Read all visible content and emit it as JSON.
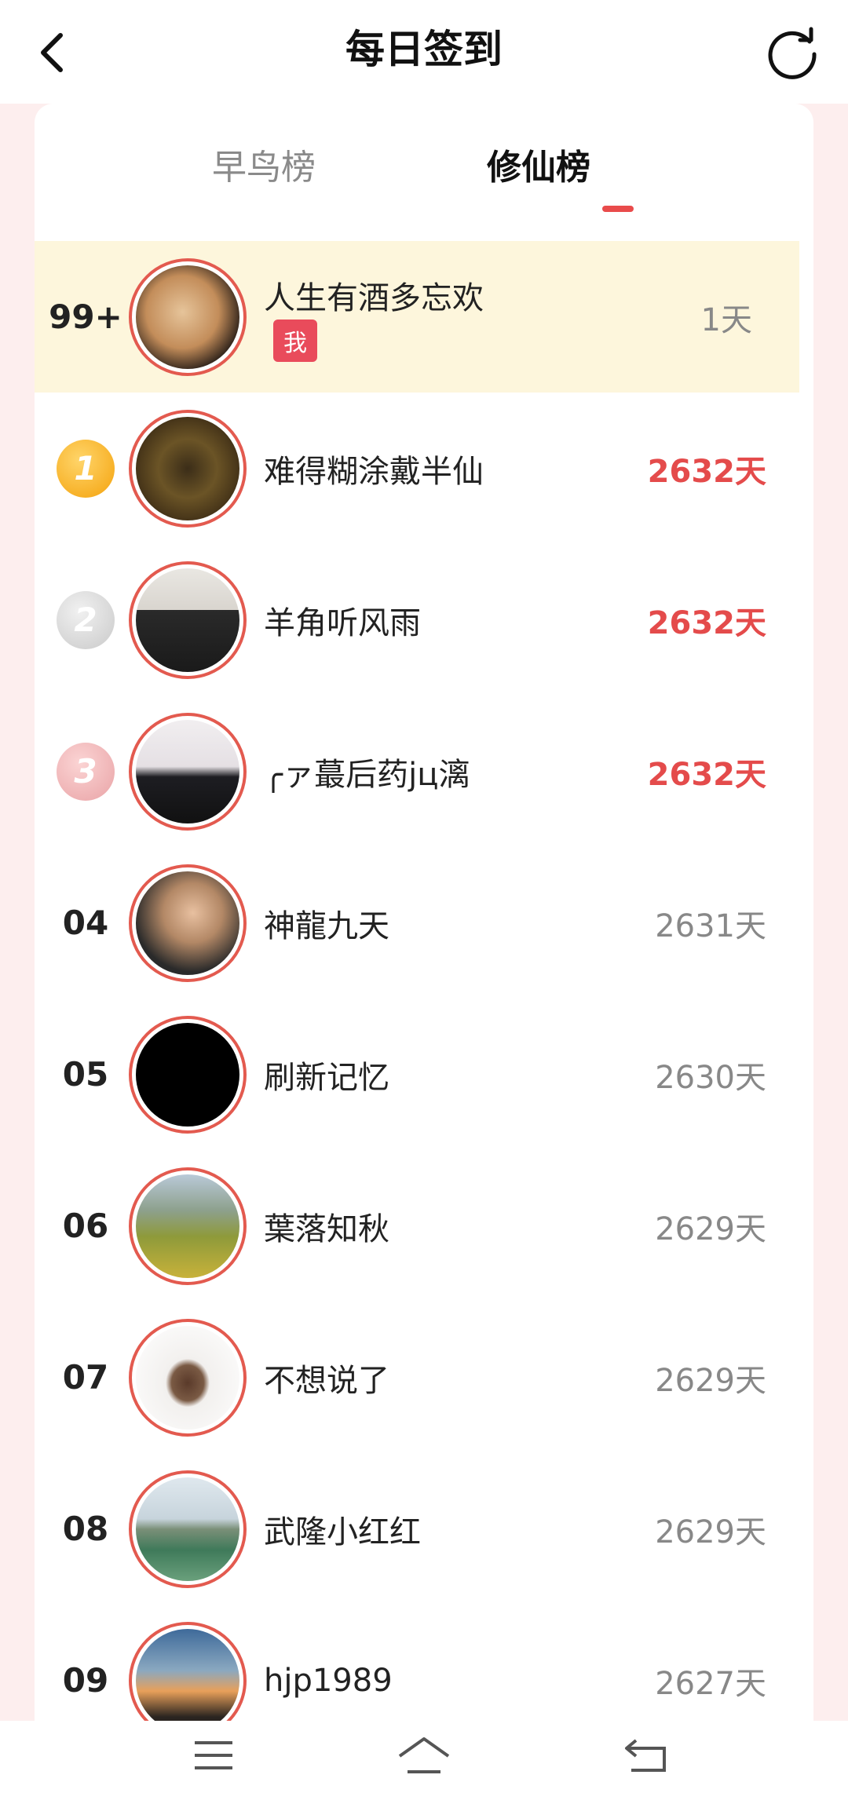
{
  "header": {
    "title": "每日签到",
    "back_icon": "chevron-left-icon",
    "refresh_icon": "refresh-icon"
  },
  "tabs": [
    {
      "label": "早鸟榜",
      "active": false
    },
    {
      "label": "修仙榜",
      "active": true
    }
  ],
  "colors": {
    "accent": "#e94b4b",
    "my_row_bg": "#fdf6dc",
    "page_bg": "#fdeeee"
  },
  "my_entry": {
    "rank": "99+",
    "name": "人生有酒多忘欢",
    "badge": "我",
    "days": "1天"
  },
  "leaderboard": [
    {
      "rank": "1",
      "medal": "gold",
      "name": "难得糊涂戴半仙",
      "days": "2632天"
    },
    {
      "rank": "2",
      "medal": "silver",
      "name": "羊角听风雨",
      "days": "2632天"
    },
    {
      "rank": "3",
      "medal": "bronze",
      "name": "╭ァ蕞后药jц漓",
      "days": "2632天"
    },
    {
      "rank": "04",
      "name": "神龍九天",
      "days": "2631天"
    },
    {
      "rank": "05",
      "name": "刷新记忆",
      "days": "2630天"
    },
    {
      "rank": "06",
      "name": "葉落知秋",
      "days": "2629天"
    },
    {
      "rank": "07",
      "name": "不想说了",
      "days": "2629天"
    },
    {
      "rank": "08",
      "name": "武隆小红红",
      "days": "2629天"
    },
    {
      "rank": "09",
      "name": "hjp1989",
      "days": "2627天"
    }
  ],
  "bottom_nav": [
    {
      "icon": "menu-icon"
    },
    {
      "icon": "home-icon"
    },
    {
      "icon": "back-icon"
    }
  ]
}
